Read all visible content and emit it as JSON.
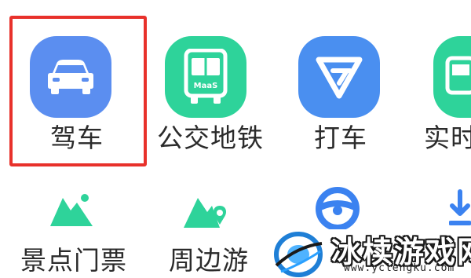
{
  "colors": {
    "drive_blue": "#5b8ef0",
    "bus_green": "#2ed39a",
    "taxi_blue": "#4a8ff0",
    "realtime_green": "#2ed39a",
    "highlight_red": "#e8312b",
    "text": "#2b2b2b"
  },
  "row1": [
    {
      "label": "驾车",
      "icon": "car-icon"
    },
    {
      "label": "公交地铁",
      "icon": "bus-icon",
      "icon_text": "MaaS"
    },
    {
      "label": "打车",
      "icon": "taxi-logo-icon"
    },
    {
      "label": "实时",
      "icon": "realtime-bus-icon"
    }
  ],
  "row2": [
    {
      "label": "景点门票",
      "icon": "mountain-icon"
    },
    {
      "label": "周边游",
      "icon": "mountain-pin-icon"
    },
    {
      "label": "",
      "icon": "steering-wheel-icon"
    },
    {
      "label": "",
      "icon": "download-icon"
    }
  ],
  "watermark": {
    "title": "冰椟游戏网",
    "url": "www.yclengku.com"
  }
}
